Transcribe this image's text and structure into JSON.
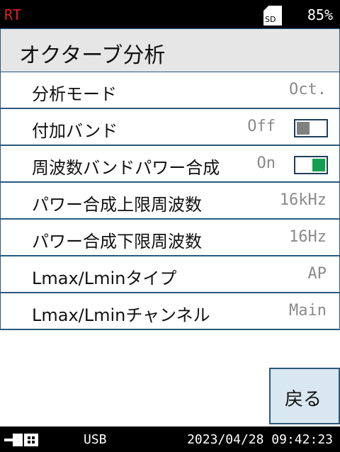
{
  "status": {
    "mode": "RT",
    "sd_label": "SD",
    "battery": "85%"
  },
  "header": {
    "title": "オクターブ分析"
  },
  "menu": {
    "items": [
      {
        "label": "分析モード",
        "value": "Oct."
      },
      {
        "label": "付加バンド",
        "value": "Off",
        "toggle": "off"
      },
      {
        "label": "周波数バンドパワー合成",
        "value": "On",
        "toggle": "on"
      },
      {
        "label": "パワー合成上限周波数",
        "value": "16kHz"
      },
      {
        "label": "パワー合成下限周波数",
        "value": "16Hz"
      },
      {
        "label": "Lmax/Lminタイプ",
        "value": "AP"
      },
      {
        "label": "Lmax/Lminチャンネル",
        "value": "Main"
      }
    ]
  },
  "buttons": {
    "back_label": "戻る"
  },
  "footer": {
    "power_icon": "plug-icon",
    "usb_label": "USB",
    "datetime": "2023/04/28  09:42:23"
  },
  "colors": {
    "accent_border": "#2b5a7e",
    "toggle_on": "#12a050",
    "toggle_off": "#808080",
    "rt_red": "#e02020"
  }
}
